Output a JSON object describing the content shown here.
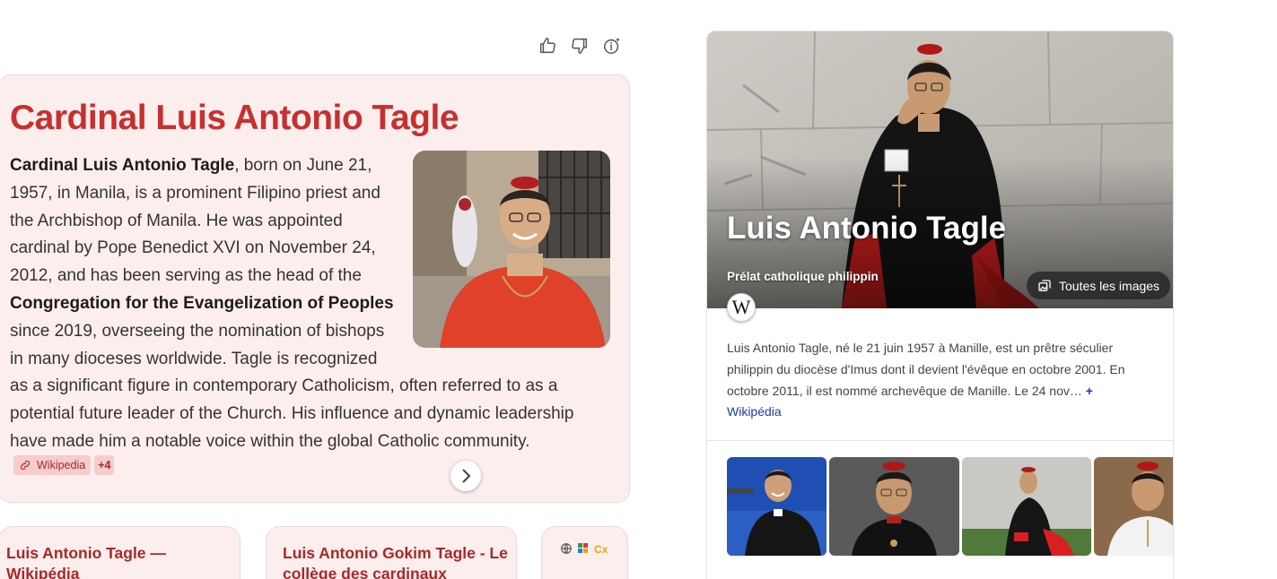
{
  "feedback": {
    "like_icon": "thumbs-up-icon",
    "dislike_icon": "thumbs-down-icon",
    "info_icon": "info-sparkle-icon"
  },
  "answer": {
    "title": "Cardinal Luis Antonio Tagle",
    "bold_name": "Cardinal Luis Antonio Tagle",
    "text_1": ", born on June 21, 1957, in Manila, is a prominent Filipino priest and the Archbishop of Manila. He was appointed cardinal by Pope Benedict XVI on November 24, 2012, and has been serving as the head of the ",
    "bold_congregation": "Congregation for the Evangelization of Peoples",
    "text_2": " since 2019, overseeing the nomination of bishops in many dioceses worldwide. Tagle is recognized as a significant figure in contemporary Catholicism, often referred to as a potential future leader of the Church. His influence and dynamic leadership have made him a notable voice within the global Catholic community.",
    "citation_label": "Wikipedia",
    "citation_more": "+4"
  },
  "sources": [
    {
      "title": "Luis Antonio Tagle — Wikipédia"
    },
    {
      "title": "Luis Antonio Gokim Tagle - Le collège des cardinaux"
    }
  ],
  "knowledge_panel": {
    "name": "Luis Antonio Tagle",
    "subtitle": "Prélat catholique philippin",
    "all_images_label": "Toutes les images",
    "wiki_logo": "W",
    "description": "Luis Antonio Tagle, né le 21 juin 1957 à Manille, est un prêtre séculier philippin du diocèse d'Imus dont il devient l'évêque en octobre 2001. En octobre 2011, il est nommé archevêque de Manille. Le 24 nov…",
    "more_label": "+",
    "source_link": "Wikipédia"
  },
  "colors": {
    "accent_red": "#c5312f",
    "card_bg": "#fdeeee",
    "link_blue": "#1a3ca8"
  }
}
